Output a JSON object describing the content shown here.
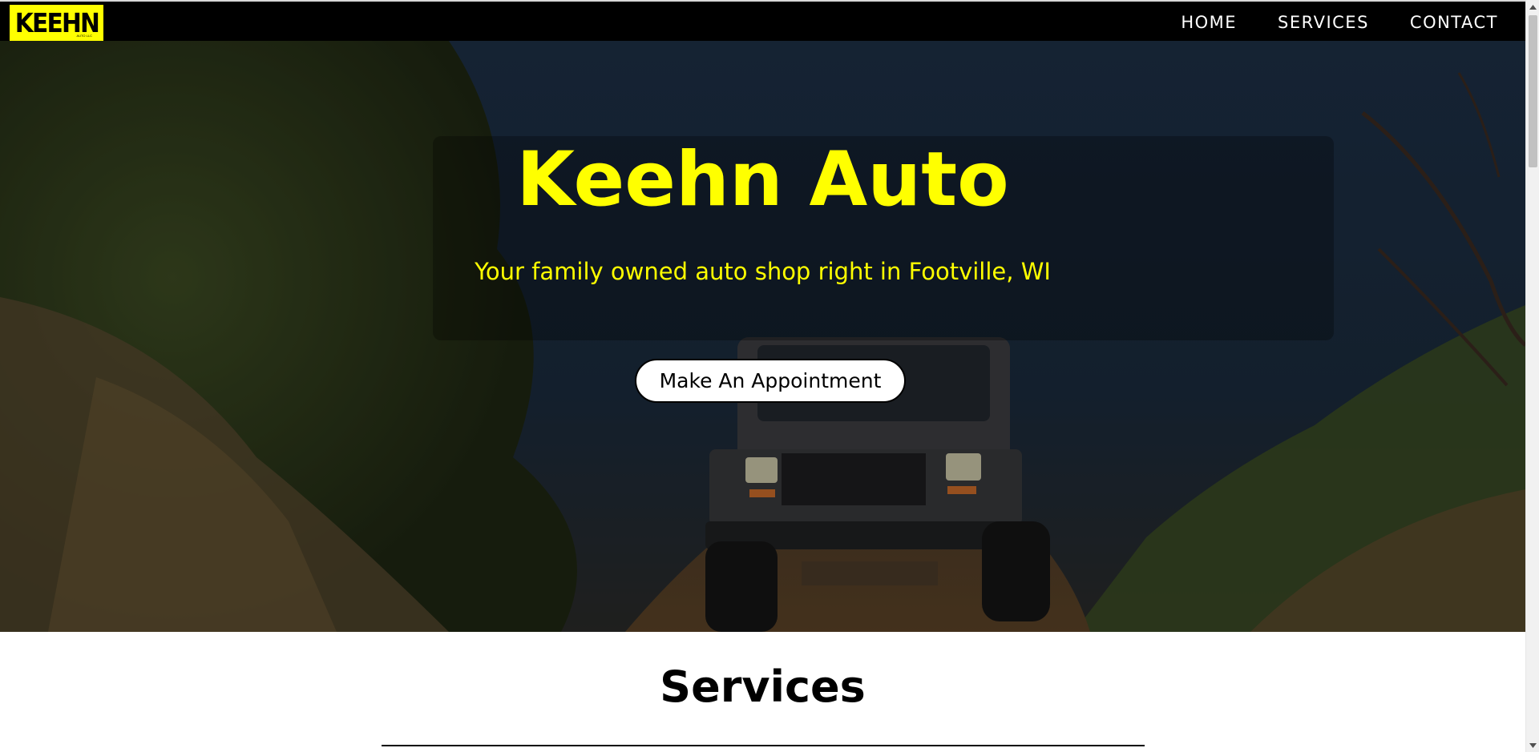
{
  "brand": {
    "logo_text": "KEEHN",
    "logo_subtext": "AUTO LLC",
    "logo_color": "#ffff00"
  },
  "nav": {
    "items": [
      {
        "label": "HOME"
      },
      {
        "label": "SERVICES"
      },
      {
        "label": "CONTACT"
      }
    ]
  },
  "hero": {
    "title": "Keehn Auto",
    "subtitle": "Your family owned auto shop right in Footville, WI",
    "cta_label": "Make An Appointment",
    "accent_color": "#ffff00"
  },
  "services": {
    "title": "Services"
  },
  "icons": [
    "chevron-up-icon",
    "chevron-down-icon"
  ]
}
